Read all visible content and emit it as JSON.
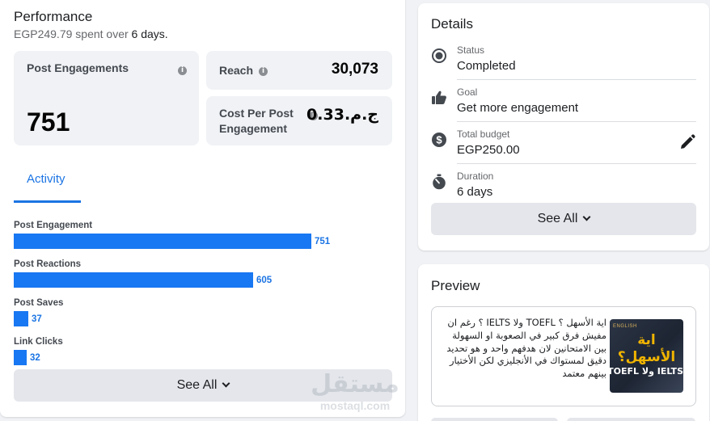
{
  "performance": {
    "title": "Performance",
    "spent_amount": "EGP249.79",
    "spent_text": "spent over",
    "days": "6 days.",
    "metrics": {
      "post_engagements": {
        "label": "Post Engagements",
        "value": "751"
      },
      "reach": {
        "label": "Reach",
        "value": "30,073"
      },
      "cost_per_engagement": {
        "label_line1": "Cost Per Post",
        "label_line2": "Engagement",
        "value": "ج.م.0.33"
      }
    },
    "tab": "Activity",
    "bars": [
      {
        "label": "Post Engagement",
        "value": 751,
        "value_text": "751"
      },
      {
        "label": "Post Reactions",
        "value": 605,
        "value_text": "605"
      },
      {
        "label": "Post Saves",
        "value": 37,
        "value_text": "37"
      },
      {
        "label": "Link Clicks",
        "value": 32,
        "value_text": "32"
      }
    ],
    "see_all": "See All"
  },
  "details": {
    "title": "Details",
    "items": [
      {
        "icon": "status-icon",
        "label": "Status",
        "value": "Completed"
      },
      {
        "icon": "thumbs-up-icon",
        "label": "Goal",
        "value": "Get more engagement"
      },
      {
        "icon": "dollar-icon",
        "label": "Total budget",
        "value": "EGP250.00"
      },
      {
        "icon": "stopwatch-icon",
        "label": "Duration",
        "value": "6 days"
      }
    ],
    "see_all": "See All"
  },
  "preview": {
    "title": "Preview",
    "text": "اية الأسهل ؟ TOEFL ولا IELTS ؟ رغم ان مفيش فرق كبير في الصعوبة او السهولة بين الامتحانين لان هدفهم واحد و هو تحديد دقيق لمستواك في الأنجليزي لكن الأختيار بينهم معتمد",
    "thumb_logo": "ENGLISH",
    "thumb_heading": "اية الأسهل؟",
    "thumb_bottom": "IELTS ولا TOEFL"
  },
  "watermark": {
    "word": "مستقل",
    "domain": "mostaql.com"
  },
  "colors": {
    "accent": "#1877f2",
    "link": "#1b74e4",
    "panel": "#f0f2f5"
  }
}
